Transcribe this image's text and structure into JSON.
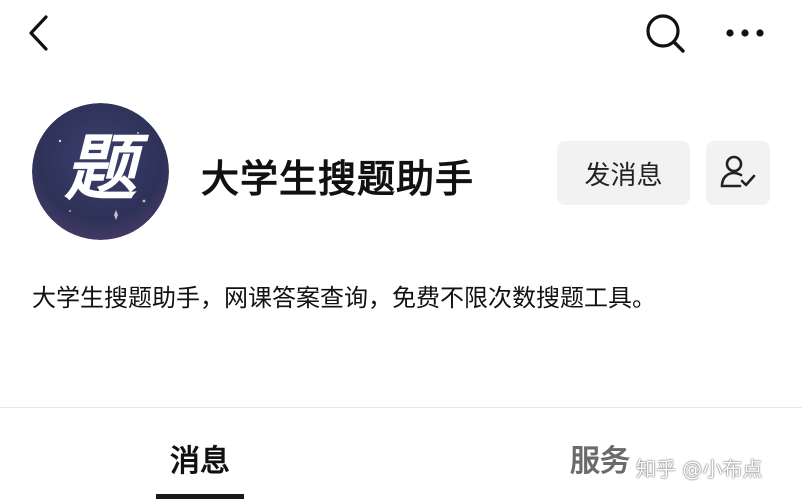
{
  "topbar": {
    "back_icon": "chevron-left-icon",
    "search_icon": "search-icon",
    "more_icon": "more-horizontal-icon"
  },
  "profile": {
    "avatar_text": "题",
    "name": "大学生搜题助手",
    "message_button_label": "发消息",
    "follow_icon": "user-check-icon",
    "description": "大学生搜题助手，网课答案查询，免费不限次数搜题工具。"
  },
  "tabs": [
    {
      "label": "消息",
      "active": true
    },
    {
      "label": "服务",
      "active": false
    }
  ],
  "watermark": "知乎 @小布点",
  "colors": {
    "tab_active": "#111111",
    "tab_inactive": "#6b6b6b",
    "button_bg": "#f2f2f2",
    "avatar_bg": "#2e3258"
  }
}
